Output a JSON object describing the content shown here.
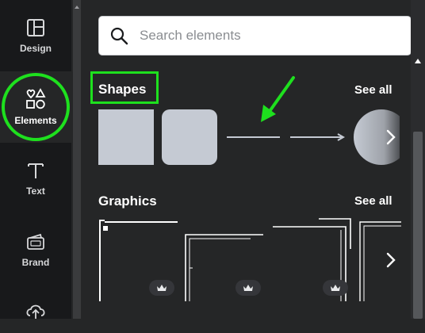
{
  "sidebar": {
    "items": [
      {
        "label": "Design",
        "icon": "layout-icon"
      },
      {
        "label": "Elements",
        "icon": "shapes-icon",
        "active": true
      },
      {
        "label": "Text",
        "icon": "text-icon"
      },
      {
        "label": "Brand",
        "icon": "brand-icon"
      },
      {
        "label": "",
        "icon": "upload-icon"
      }
    ]
  },
  "search": {
    "placeholder": "Search elements"
  },
  "shapes": {
    "title": "Shapes",
    "see_all": "See all"
  },
  "graphics": {
    "title": "Graphics",
    "see_all": "See all"
  },
  "colors": {
    "accent_highlight": "#1ee01e",
    "shape_fill": "#c5cad3",
    "panel_bg": "#252627",
    "rail_bg": "#18191b"
  }
}
